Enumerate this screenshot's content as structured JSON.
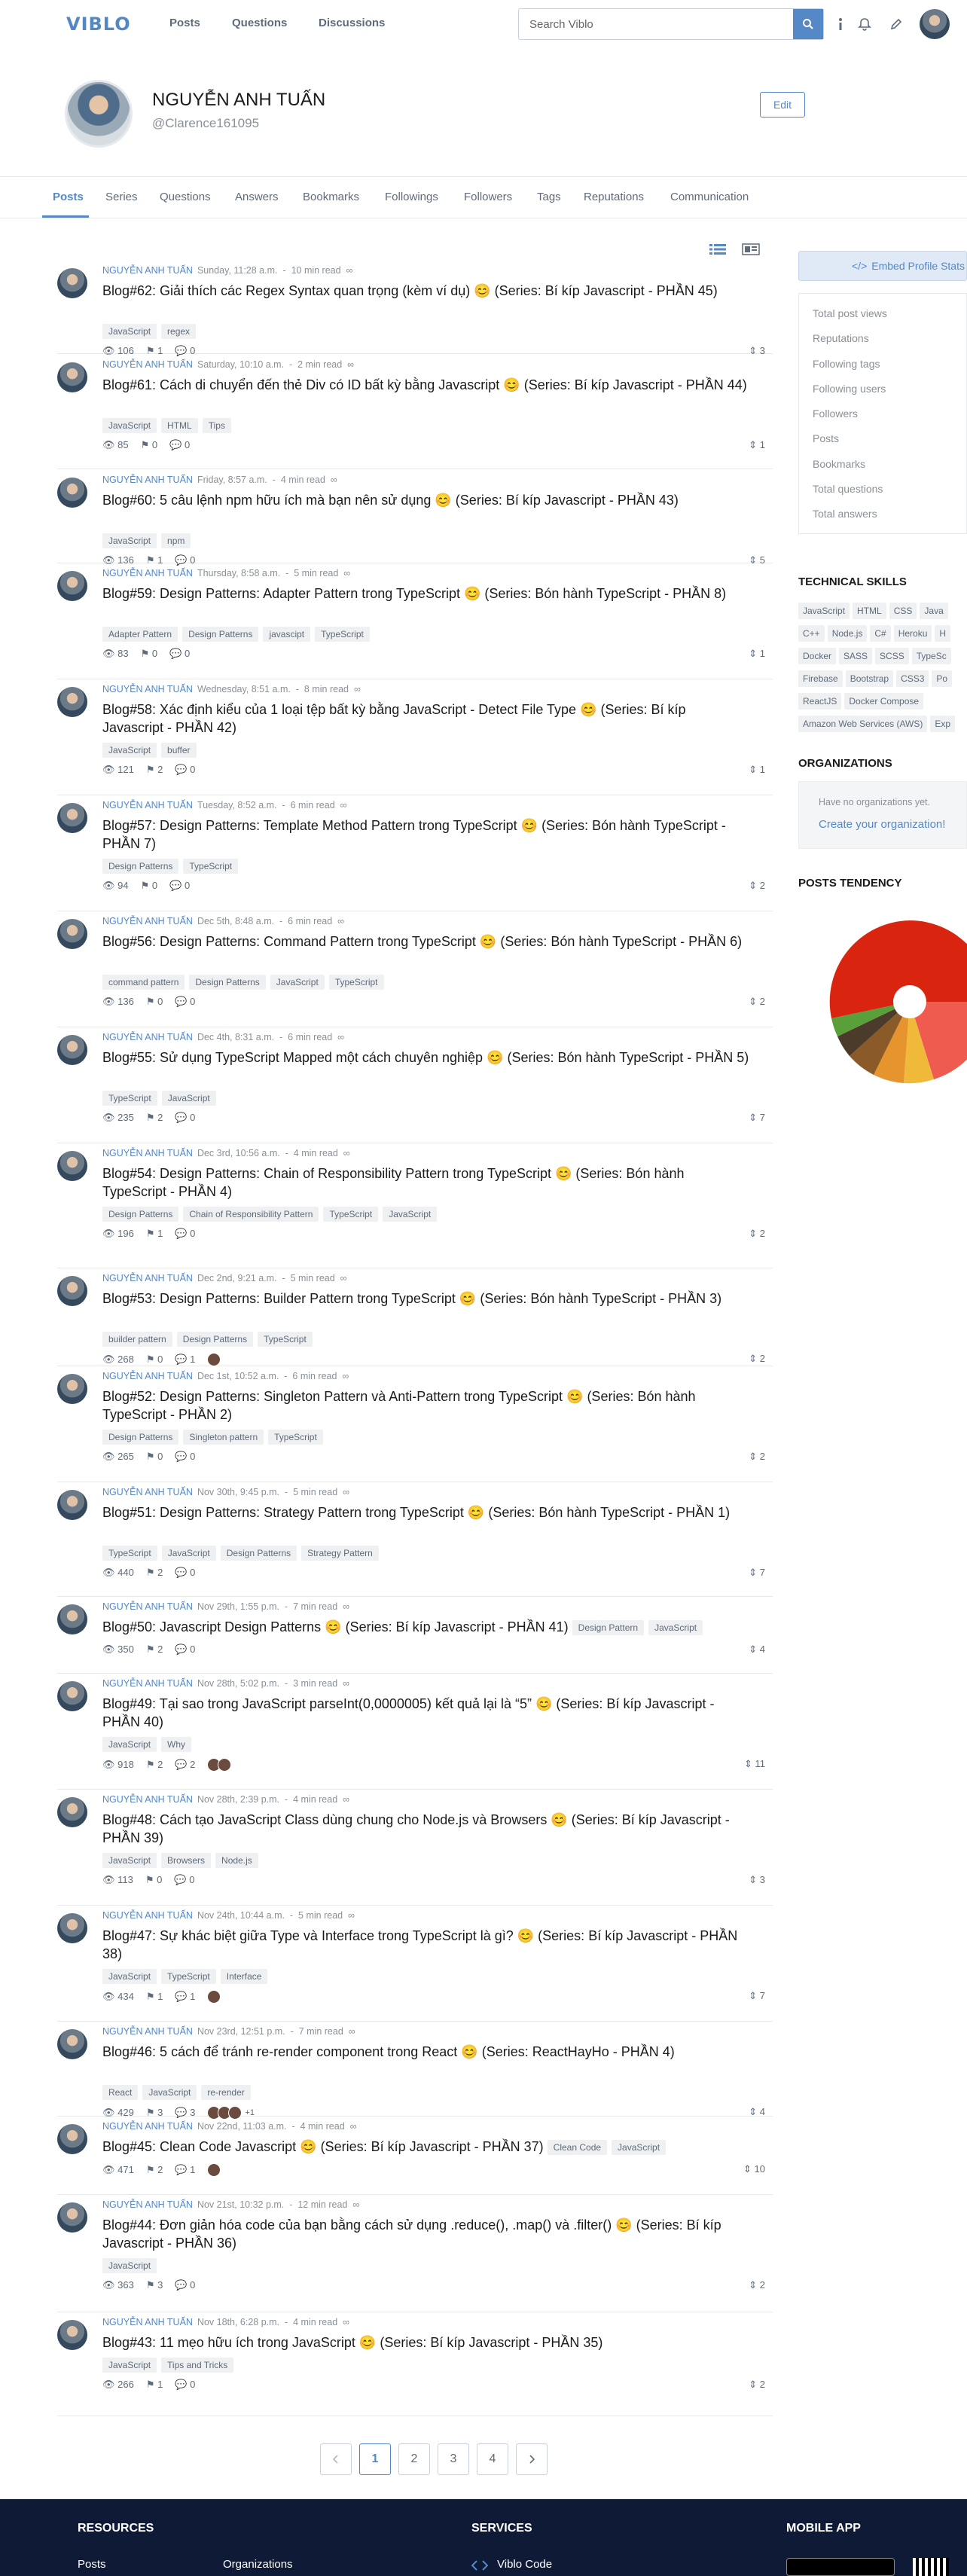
{
  "header": {
    "logo": "VIBLO",
    "nav": [
      "Posts",
      "Questions",
      "Discussions"
    ],
    "search_placeholder": "Search Viblo"
  },
  "profile": {
    "name": "NGUYỄN ANH TUẤN",
    "username": "@Clarence161095",
    "edit_label": "Edit"
  },
  "tabs": [
    "Posts",
    "Series",
    "Questions",
    "Answers",
    "Bookmarks",
    "Followings",
    "Followers",
    "Tags",
    "Reputations",
    "Communication"
  ],
  "posts": [
    {
      "author": "NGUYỄN ANH TUẤN",
      "date": "Sunday, 11:28 a.m.",
      "read": "10 min read",
      "title": "Blog#62: Giải thích các Regex Syntax quan trọng (kèm ví dụ) 😊 (Series: Bí kíp Javascript - PHẦN 45)",
      "tags": [
        "JavaScript",
        "regex"
      ],
      "views": "106",
      "clips": "1",
      "comments": "0",
      "score": "3"
    },
    {
      "author": "NGUYỄN ANH TUẤN",
      "date": "Saturday, 10:10 a.m.",
      "read": "2 min read",
      "title": "Blog#61: Cách di chuyển đến thẻ Div có ID bất kỳ bằng Javascript 😊 (Series: Bí kíp Javascript - PHẦN 44)",
      "tags": [
        "JavaScript",
        "HTML",
        "Tips"
      ],
      "views": "85",
      "clips": "0",
      "comments": "0",
      "score": "1"
    },
    {
      "author": "NGUYỄN ANH TUẤN",
      "date": "Friday, 8:57 a.m.",
      "read": "4 min read",
      "title": "Blog#60: 5 câu lệnh npm hữu ích mà bạn nên sử dụng 😊 (Series: Bí kíp Javascript - PHẦN 43)",
      "tags": [
        "JavaScript",
        "npm"
      ],
      "views": "136",
      "clips": "1",
      "comments": "0",
      "score": "5"
    },
    {
      "author": "NGUYỄN ANH TUẤN",
      "date": "Thursday, 8:58 a.m.",
      "read": "5 min read",
      "title": "Blog#59: Design Patterns: Adapter Pattern trong TypeScript 😊 (Series: Bón hành TypeScript - PHẦN 8)",
      "tags": [
        "Adapter Pattern",
        "Design Patterns",
        "javascipt",
        "TypeScript"
      ],
      "views": "83",
      "clips": "0",
      "comments": "0",
      "score": "1"
    },
    {
      "author": "NGUYỄN ANH TUẤN",
      "date": "Wednesday, 8:51 a.m.",
      "read": "8 min read",
      "title": "Blog#58: Xác định kiểu của 1 loại tệp bất kỳ bằng JavaScript - Detect File Type 😊 (Series: Bí kíp Javascript - PHẦN 42)",
      "tags": [
        "JavaScript",
        "buffer"
      ],
      "views": "121",
      "clips": "2",
      "comments": "0",
      "score": "1"
    },
    {
      "author": "NGUYỄN ANH TUẤN",
      "date": "Tuesday, 8:52 a.m.",
      "read": "6 min read",
      "title": "Blog#57: Design Patterns: Template Method Pattern trong TypeScript 😊 (Series: Bón hành TypeScript - PHẦN 7)",
      "tags": [
        "Design Patterns",
        "TypeScript"
      ],
      "views": "94",
      "clips": "0",
      "comments": "0",
      "score": "2"
    },
    {
      "author": "NGUYỄN ANH TUẤN",
      "date": "Dec 5th, 8:48 a.m.",
      "read": "6 min read",
      "title": "Blog#56: Design Patterns: Command Pattern trong TypeScript 😊 (Series: Bón hành TypeScript - PHẦN 6)",
      "tags": [
        "command pattern",
        "Design Patterns",
        "JavaScript",
        "TypeScript"
      ],
      "views": "136",
      "clips": "0",
      "comments": "0",
      "score": "2"
    },
    {
      "author": "NGUYỄN ANH TUẤN",
      "date": "Dec 4th, 8:31 a.m.",
      "read": "6 min read",
      "title": "Blog#55: Sử dụng TypeScript Mapped một cách chuyên nghiệp 😊 (Series: Bón hành TypeScript - PHẦN 5)",
      "tags": [
        "TypeScript",
        "JavaScript"
      ],
      "views": "235",
      "clips": "2",
      "comments": "0",
      "score": "7"
    },
    {
      "author": "NGUYỄN ANH TUẤN",
      "date": "Dec 3rd, 10:56 a.m.",
      "read": "4 min read",
      "title": "Blog#54: Design Patterns: Chain of Responsibility Pattern trong TypeScript 😊 (Series: Bón hành TypeScript - PHẦN 4)",
      "tags": [
        "Design Patterns",
        "Chain of Responsibility Pattern",
        "TypeScript",
        "JavaScript"
      ],
      "views": "196",
      "clips": "1",
      "comments": "0",
      "score": "2"
    },
    {
      "author": "NGUYỄN ANH TUẤN",
      "date": "Dec 2nd, 9:21 a.m.",
      "read": "5 min read",
      "title": "Blog#53: Design Patterns: Builder Pattern trong TypeScript 😊 (Series: Bón hành TypeScript - PHẦN 3)",
      "tags": [
        "builder pattern",
        "Design Patterns",
        "TypeScript"
      ],
      "views": "268",
      "clips": "0",
      "comments": "1",
      "score": "2"
    },
    {
      "author": "NGUYỄN ANH TUẤN",
      "date": "Dec 1st, 10:52 a.m.",
      "read": "6 min read",
      "title": "Blog#52: Design Patterns: Singleton Pattern và Anti-Pattern trong TypeScript 😊 (Series: Bón hành TypeScript - PHẦN 2)",
      "tags": [
        "Design Patterns",
        "Singleton pattern",
        "TypeScript"
      ],
      "views": "265",
      "clips": "0",
      "comments": "0",
      "score": "2"
    },
    {
      "author": "NGUYỄN ANH TUẤN",
      "date": "Nov 30th, 9:45 p.m.",
      "read": "5 min read",
      "title": "Blog#51: Design Patterns: Strategy Pattern trong TypeScript 😊 (Series: Bón hành TypeScript - PHẦN 1)",
      "tags": [
        "TypeScript",
        "JavaScript",
        "Design Patterns",
        "Strategy Pattern"
      ],
      "views": "440",
      "clips": "2",
      "comments": "0",
      "score": "7"
    },
    {
      "author": "NGUYỄN ANH TUẤN",
      "date": "Nov 29th, 1:55 p.m.",
      "read": "7 min read",
      "title": "Blog#50: Javascript Design Patterns 😊 (Series: Bí kíp Javascript - PHẦN 41)",
      "tags": [
        "Design Pattern",
        "JavaScript"
      ],
      "views": "350",
      "clips": "2",
      "comments": "0",
      "score": "4"
    },
    {
      "author": "NGUYỄN ANH TUẤN",
      "date": "Nov 28th, 5:02 p.m.",
      "read": "3 min read",
      "title": "Blog#49: Tại sao trong JavaScript parseInt(0,0000005) kết quả lại là “5” 😊 (Series: Bí kíp Javascript - PHẦN 40)",
      "tags": [
        "JavaScript",
        "Why"
      ],
      "views": "918",
      "clips": "2",
      "comments": "2",
      "score": "11"
    },
    {
      "author": "NGUYỄN ANH TUẤN",
      "date": "Nov 28th, 2:39 p.m.",
      "read": "4 min read",
      "title": "Blog#48: Cách tạo JavaScript Class dùng chung cho Node.js và Browsers 😊 (Series: Bí kíp Javascript - PHẦN 39)",
      "tags": [
        "JavaScript",
        "Browsers",
        "Node.js"
      ],
      "views": "113",
      "clips": "0",
      "comments": "0",
      "score": "3"
    },
    {
      "author": "NGUYỄN ANH TUẤN",
      "date": "Nov 24th, 10:44 a.m.",
      "read": "5 min read",
      "title": "Blog#47: Sự khác biệt giữa Type và Interface trong TypeScript là gì? 😊 (Series: Bí kíp Javascript - PHẦN 38)",
      "tags": [
        "JavaScript",
        "TypeScript",
        "Interface"
      ],
      "views": "434",
      "clips": "1",
      "comments": "1",
      "score": "7"
    },
    {
      "author": "NGUYỄN ANH TUẤN",
      "date": "Nov 23rd, 12:51 p.m.",
      "read": "7 min read",
      "title": "Blog#46: 5 cách để tránh re-render component trong React 😊 (Series: ReactHayHo - PHẦN 4)",
      "tags": [
        "React",
        "JavaScript",
        "re-render"
      ],
      "views": "429",
      "clips": "3",
      "comments": "3",
      "score": "4",
      "extra": "+1"
    },
    {
      "author": "NGUYỄN ANH TUẤN",
      "date": "Nov 22nd, 11:03 a.m.",
      "read": "4 min read",
      "title": "Blog#45: Clean Code Javascript 😊 (Series: Bí kíp Javascript - PHẦN 37)",
      "tags": [
        "Clean Code",
        "JavaScript"
      ],
      "views": "471",
      "clips": "2",
      "comments": "1",
      "score": "10"
    },
    {
      "author": "NGUYỄN ANH TUẤN",
      "date": "Nov 21st, 10:32 p.m.",
      "read": "12 min read",
      "title": "Blog#44: Đơn giản hóa code của bạn bằng cách sử dụng .reduce(), .map() và .filter() 😊 (Series: Bí kíp Javascript - PHẦN 36)",
      "tags": [
        "JavaScript"
      ],
      "views": "363",
      "clips": "3",
      "comments": "0",
      "score": "2"
    },
    {
      "author": "NGUYỄN ANH TUẤN",
      "date": "Nov 18th, 6:28 p.m.",
      "read": "4 min read",
      "title": "Blog#43: 11 mẹo hữu ích trong JavaScript 😊 (Series: Bí kíp Javascript - PHẦN 35)",
      "tags": [
        "JavaScript",
        "Tips and Tricks"
      ],
      "views": "266",
      "clips": "1",
      "comments": "0",
      "score": "2"
    }
  ],
  "pagination": [
    "1",
    "2",
    "3",
    "4"
  ],
  "sidebar": {
    "embed_label": "Embed Profile Stats",
    "stats": [
      "Total post views",
      "Reputations",
      "Following tags",
      "Following users",
      "Followers",
      "Posts",
      "Bookmarks",
      "Total questions",
      "Total answers"
    ],
    "skills_title": "TECHNICAL SKILLS",
    "skills": [
      "JavaScript",
      "HTML",
      "CSS",
      "Java",
      "C++",
      "Node.js",
      "C#",
      "Heroku",
      "H",
      "Docker",
      "SASS",
      "SCSS",
      "TypeSc",
      "Firebase",
      "Bootstrap",
      "CSS3",
      "Po",
      "ReactJS",
      "Docker Compose",
      "Amazon Web Services (AWS)",
      "Exp"
    ],
    "org_title": "ORGANIZATIONS",
    "org_none": "Have no organizations yet.",
    "org_create": "Create your organization!",
    "tendency_title": "POSTS TENDENCY"
  },
  "colors": {
    "accent": "#5488c7",
    "footer": "#0f1b36"
  },
  "footer": {
    "resources": "RESOURCES",
    "services": "SERVICES",
    "mobile": "MOBILE APP",
    "links": [
      "Posts",
      "Organizations",
      "Viblo Code"
    ]
  }
}
